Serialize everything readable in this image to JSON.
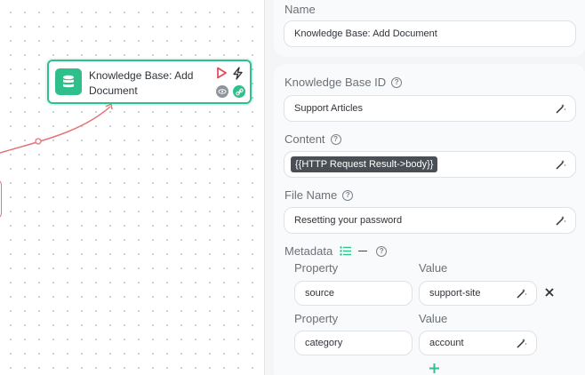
{
  "canvas": {
    "node": {
      "title": "Knowledge Base: Add Document",
      "icon": "database-icon",
      "accent": "#2fc08c"
    }
  },
  "panel": {
    "name": {
      "label": "Name",
      "value": "Knowledge Base: Add Document"
    },
    "knowledge_base_id": {
      "label": "Knowledge Base ID",
      "value": "Support Articles"
    },
    "content": {
      "label": "Content",
      "token": "{{HTTP Request Result->body}}"
    },
    "file_name": {
      "label": "File Name",
      "value": "Resetting your password"
    },
    "metadata": {
      "label": "Metadata",
      "property_header": "Property",
      "value_header": "Value",
      "rows": [
        {
          "property": "source",
          "value": "support-site"
        },
        {
          "property": "category",
          "value": "account"
        }
      ]
    }
  },
  "colors": {
    "node_accent": "#2fc08c",
    "edge": "#e6747a",
    "run_icon": "#e0475a",
    "token_bg": "#4a4f55",
    "list_icon": "#2fc08c"
  }
}
